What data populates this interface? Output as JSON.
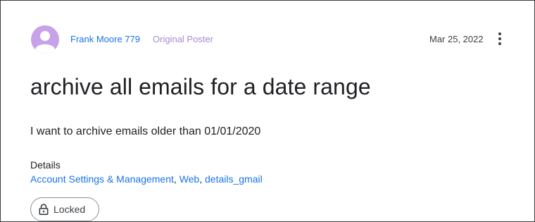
{
  "post": {
    "author": "Frank Moore 779",
    "author_badge": "Original Poster",
    "date": "Mar 25, 2022",
    "title": "archive all emails for a date range",
    "body": "I want to archive emails older than 01/01/2020"
  },
  "details": {
    "heading": "Details",
    "tags": [
      "Account Settings & Management",
      "Web",
      "details_gmail"
    ],
    "separator": ", "
  },
  "status_chip": {
    "label": "Locked",
    "icon": "lock-icon"
  },
  "colors": {
    "link": "#1a73e8",
    "badge": "#a58bd6",
    "avatar": "#c7a2e8"
  },
  "icons": {
    "avatar": "person-icon",
    "more": "more-vert-icon"
  }
}
